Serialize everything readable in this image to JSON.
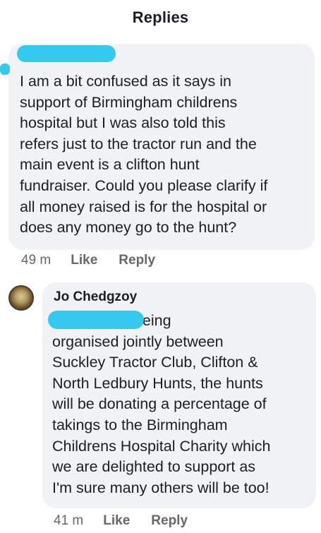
{
  "header": {
    "title": "Replies"
  },
  "comments": [
    {
      "author": "",
      "body": "I am a bit confused as it says in\nsupport of Birmingham childrens\nhospital but I was also told this\nrefers just to the tractor run and the\nmain event is a clifton hunt\nfundraiser. Could you please clarify if\nall money raised is for the hospital or\ndoes any money go to the hunt?",
      "time": "49 m",
      "like_label": "Like",
      "reply_label": "Reply"
    },
    {
      "author": "Jo Chedgzoy",
      "body": "                               the event is being\norganised jointly between\nSuckley Tractor Club, Clifton &\nNorth Ledbury Hunts, the hunts\nwill be donating a percentage of\ntakings to the Birmingham\nChildrens Hospital Charity which\nwe are delighted to support as\nI'm sure many others will be too!",
      "time": "41 m",
      "like_label": "Like",
      "reply_label": "Reply"
    }
  ],
  "colors": {
    "bubble": "#f0f2f5",
    "redaction": "#36c9f0",
    "meta": "#65676b"
  }
}
